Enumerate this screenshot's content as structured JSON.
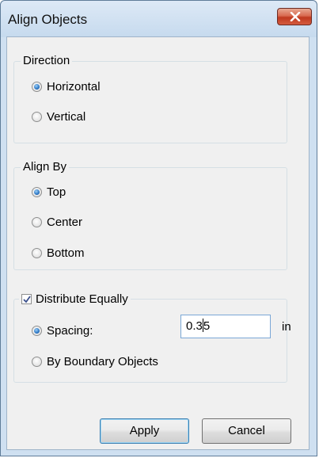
{
  "window": {
    "title": "Align Objects"
  },
  "direction": {
    "label": "Direction",
    "options": [
      {
        "label": "Horizontal",
        "checked": true
      },
      {
        "label": "Vertical",
        "checked": false
      }
    ]
  },
  "align_by": {
    "label": "Align By",
    "options": [
      {
        "label": "Top",
        "checked": true
      },
      {
        "label": "Center",
        "checked": false
      },
      {
        "label": "Bottom",
        "checked": false
      }
    ]
  },
  "distribute": {
    "label": "Distribute Equally",
    "checked": true,
    "spacing_label": "Spacing:",
    "spacing_value_before_caret": "0.3",
    "spacing_value_after_caret": "5",
    "unit": "in",
    "boundary_label": "By Boundary Objects"
  },
  "buttons": {
    "apply": "Apply",
    "cancel": "Cancel"
  },
  "icons": {
    "close": "close-icon",
    "check": "checkmark-icon"
  },
  "colors": {
    "close_button": "#c0391f",
    "radio_selected": "#2c76c4",
    "input_border": "#7aa7d6"
  }
}
